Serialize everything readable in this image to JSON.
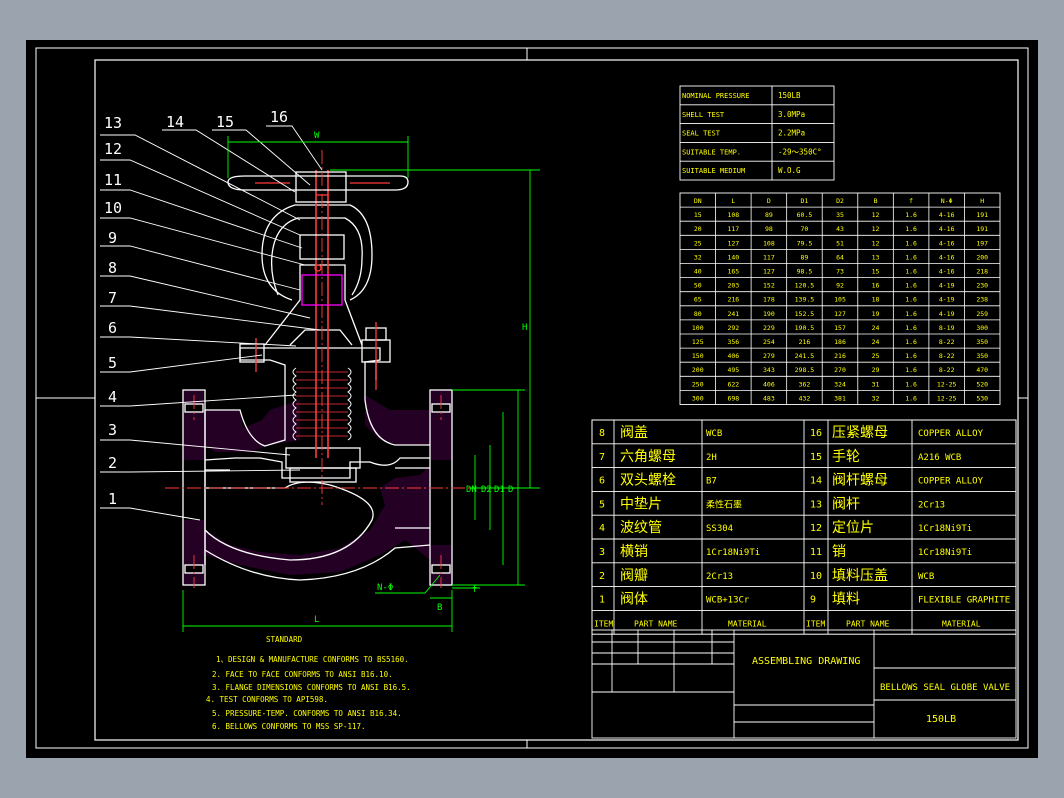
{
  "colors": {
    "canvas": "#000000",
    "frame": "#ffffff",
    "outline": "#ffffff",
    "leader": "#ffffff",
    "dimension": "#00ff00",
    "table_text": "#ffff00",
    "center_line": "#ff3b3b",
    "accent": "#ff00ff",
    "background": "#9aa3ae"
  },
  "callouts": [
    "1",
    "2",
    "3",
    "4",
    "5",
    "6",
    "7",
    "8",
    "9",
    "10",
    "11",
    "12",
    "13",
    "14",
    "15",
    "16"
  ],
  "dimension_labels": {
    "handwheel": "W",
    "height": "H",
    "bore_1": "DN",
    "bore_2": "D2",
    "bore_3": "D1",
    "flange": "D",
    "length": "L",
    "flange_thk": "f",
    "raised_face": "B",
    "bolt_holes": "N-Φ"
  },
  "spec_table": {
    "rows": [
      {
        "label": "NOMINAL PRESSURE",
        "value": "150LB"
      },
      {
        "label": "SHELL TEST",
        "value": "3.0MPa"
      },
      {
        "label": "SEAL TEST",
        "value": "2.2MPa"
      },
      {
        "label": "SUITABLE TEMP.",
        "value": "-29～350C°"
      },
      {
        "label": "SUITABLE MEDIUM",
        "value": "W.O.G"
      }
    ]
  },
  "dim_table": {
    "headers": [
      "DN",
      "L",
      "D",
      "D1",
      "D2",
      "B",
      "f",
      "N-Φ",
      "H"
    ],
    "rows": [
      [
        "15",
        "108",
        "89",
        "60.5",
        "35",
        "12",
        "1.6",
        "4-16",
        "191"
      ],
      [
        "20",
        "117",
        "98",
        "70",
        "43",
        "12",
        "1.6",
        "4-16",
        "191"
      ],
      [
        "25",
        "127",
        "108",
        "79.5",
        "51",
        "12",
        "1.6",
        "4-16",
        "197"
      ],
      [
        "32",
        "140",
        "117",
        "89",
        "64",
        "13",
        "1.6",
        "4-16",
        "200"
      ],
      [
        "40",
        "165",
        "127",
        "98.5",
        "73",
        "15",
        "1.6",
        "4-16",
        "218"
      ],
      [
        "50",
        "203",
        "152",
        "120.5",
        "92",
        "16",
        "1.6",
        "4-19",
        "230"
      ],
      [
        "65",
        "216",
        "178",
        "139.5",
        "105",
        "18",
        "1.6",
        "4-19",
        "238"
      ],
      [
        "80",
        "241",
        "190",
        "152.5",
        "127",
        "19",
        "1.6",
        "4-19",
        "259"
      ],
      [
        "100",
        "292",
        "229",
        "190.5",
        "157",
        "24",
        "1.6",
        "8-19",
        "300"
      ],
      [
        "125",
        "356",
        "254",
        "216",
        "186",
        "24",
        "1.6",
        "8-22",
        "350"
      ],
      [
        "150",
        "406",
        "279",
        "241.5",
        "216",
        "25",
        "1.6",
        "8-22",
        "350"
      ],
      [
        "200",
        "495",
        "343",
        "298.5",
        "270",
        "29",
        "1.6",
        "8-22",
        "470"
      ],
      [
        "250",
        "622",
        "406",
        "362",
        "324",
        "31",
        "1.6",
        "12-25",
        "520"
      ],
      [
        "300",
        "698",
        "483",
        "432",
        "381",
        "32",
        "1.6",
        "12-25",
        "530"
      ]
    ]
  },
  "bom": {
    "rows": [
      {
        "l_item": "8",
        "l_name": "阀盖",
        "l_mat": "WCB",
        "r_item": "16",
        "r_name": "压紧螺母",
        "r_mat": "COPPER ALLOY"
      },
      {
        "l_item": "7",
        "l_name": "六角螺母",
        "l_mat": "2H",
        "r_item": "15",
        "r_name": "手轮",
        "r_mat": "A216 WCB"
      },
      {
        "l_item": "6",
        "l_name": "双头螺栓",
        "l_mat": "B7",
        "r_item": "14",
        "r_name": "阀杆螺母",
        "r_mat": "COPPER ALLOY"
      },
      {
        "l_item": "5",
        "l_name": "中垫片",
        "l_mat": "柔性石墨",
        "r_item": "13",
        "r_name": "阀杆",
        "r_mat": "2Cr13"
      },
      {
        "l_item": "4",
        "l_name": "波纹管",
        "l_mat": "SS304",
        "r_item": "12",
        "r_name": "定位片",
        "r_mat": "1Cr18Ni9Ti"
      },
      {
        "l_item": "3",
        "l_name": "横销",
        "l_mat": "1Cr18Ni9Ti",
        "r_item": "11",
        "r_name": "销",
        "r_mat": "1Cr18Ni9Ti"
      },
      {
        "l_item": "2",
        "l_name": "阀瓣",
        "l_mat": "2Cr13",
        "r_item": "10",
        "r_name": "填料压盖",
        "r_mat": "WCB"
      },
      {
        "l_item": "1",
        "l_name": "阀体",
        "l_mat": "WCB+13Cr",
        "r_item": "9",
        "r_name": "填料",
        "r_mat": "FLEXIBLE GRAPHITE"
      }
    ],
    "header": {
      "item": "ITEM",
      "name": "PART NAME",
      "material": "MATERIAL"
    }
  },
  "title_block": {
    "drawing_type": "ASSEMBLING DRAWING",
    "product": "BELLOWS SEAL GLOBE VALVE",
    "rating": "150LB"
  },
  "standard": {
    "heading": "STANDARD",
    "notes": [
      "1、DESIGN & MANUFACTURE CONFORMS TO BS5160.",
      "2. FACE TO FACE CONFORMS TO ANSI B16.10.",
      "3. FLANGE DIMENSIONS CONFORMS TO ANSI B16.5.",
      "4. TEST CONFORMS TO API598.",
      "5. PRESSURE-TEMP. CONFORMS TO ANSI B16.34.",
      "6. BELLOWS CONFORMS TO MSS SP-117."
    ]
  }
}
